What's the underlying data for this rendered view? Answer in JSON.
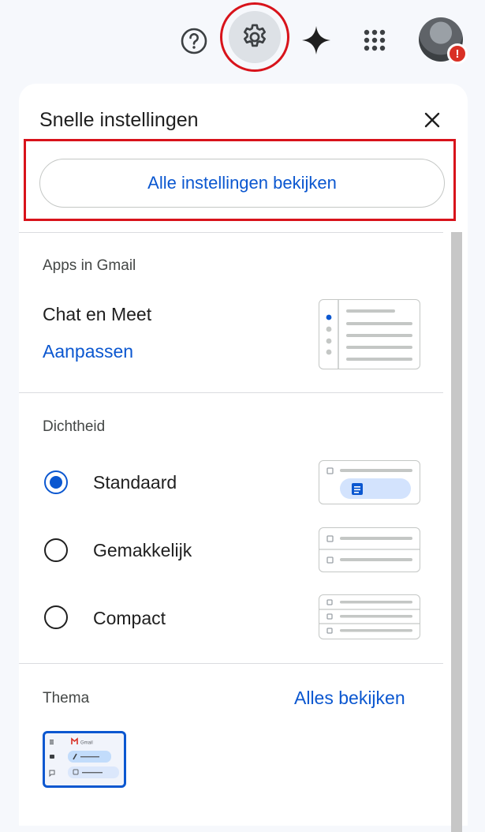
{
  "panel": {
    "title": "Snelle instellingen",
    "all_settings_button": "Alle instellingen bekijken"
  },
  "apps_section": {
    "title": "Apps in Gmail",
    "item_label": "Chat en Meet",
    "customize_link": "Aanpassen"
  },
  "density_section": {
    "title": "Dichtheid",
    "options": [
      {
        "label": "Standaard",
        "selected": true
      },
      {
        "label": "Gemakkelijk",
        "selected": false
      },
      {
        "label": "Compact",
        "selected": false
      }
    ]
  },
  "theme_section": {
    "title": "Thema",
    "see_all_link": "Alles bekijken",
    "thumbnail_brand": "Gmail"
  },
  "icons": [
    "help-icon",
    "settings-gear-icon",
    "gemini-spark-icon",
    "apps-grid-icon",
    "account-avatar",
    "close-icon"
  ],
  "colors": {
    "accent": "#0b57d0",
    "highlight_red": "#d8131b",
    "alert_red": "#d93025"
  }
}
